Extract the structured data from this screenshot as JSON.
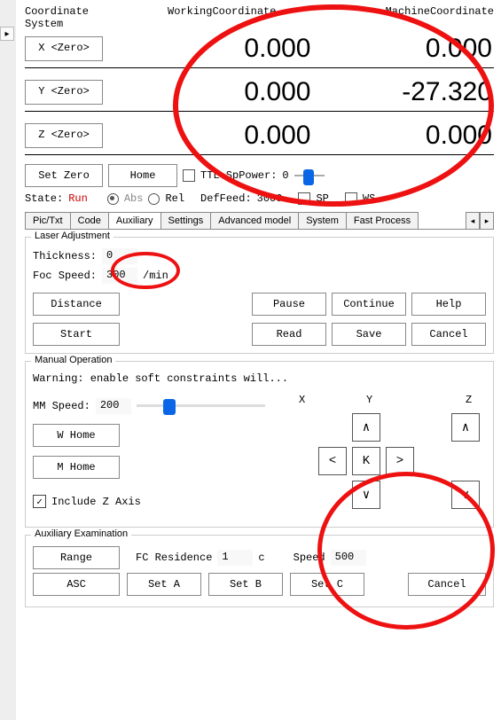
{
  "coord": {
    "group_label": "Coordinate System",
    "working_label": "WorkingCoordinate",
    "machine_label": "MachineCoordinate",
    "x_btn": "X <Zero>",
    "y_btn": "Y <Zero>",
    "z_btn": "Z <Zero>",
    "x_work": "0.000",
    "x_mach": "0.000",
    "y_work": "0.000",
    "y_mach": "-27.320",
    "z_work": "0.000",
    "z_mach": "0.000"
  },
  "ctrl": {
    "set_zero": "Set Zero",
    "home": "Home",
    "ttl_label": "TTL SpPower:",
    "ttl_value": "0",
    "state_label": "State:",
    "state_value": "Run",
    "abs": "Abs",
    "rel": "Rel",
    "deffeed_label": "DefFeed:",
    "deffeed_value": "3000",
    "sp": "SP",
    "ws": "WS"
  },
  "tabs": {
    "items": [
      "Pic/Txt",
      "Code",
      "Auxiliary",
      "Settings",
      "Advanced model",
      "System",
      "Fast Process"
    ],
    "active_index": 2
  },
  "laser": {
    "title": "Laser Adjustment",
    "thickness_label": "Thickness:",
    "thickness_value": "0",
    "foc_label": "Foc Speed:",
    "foc_value": "300",
    "foc_unit": "/min",
    "distance": "Distance",
    "start": "Start",
    "pause": "Pause",
    "continue": "Continue",
    "help": "Help",
    "read": "Read",
    "save": "Save",
    "cancel": "Cancel"
  },
  "manual": {
    "title": "Manual Operation",
    "warning": "Warning: enable soft constraints will...",
    "mm_label": "MM Speed:",
    "mm_value": "200",
    "w_home": "W Home",
    "m_home": "M Home",
    "include_z": "Include Z Axis",
    "x": "X",
    "y": "Y",
    "z": "Z",
    "k": "K",
    "up": "∧",
    "down": "∨",
    "left": "<",
    "right": ">"
  },
  "aux_exam": {
    "title": "Auxiliary Examination",
    "range": "Range",
    "fc_label": "FC Residence",
    "fc_value": "1",
    "fc_unit": "c",
    "speed_label": "Speed",
    "speed_value": "500",
    "asc": "ASC",
    "set_a": "Set A",
    "set_b": "Set B",
    "set_c": "Set C",
    "cancel": "Cancel"
  }
}
